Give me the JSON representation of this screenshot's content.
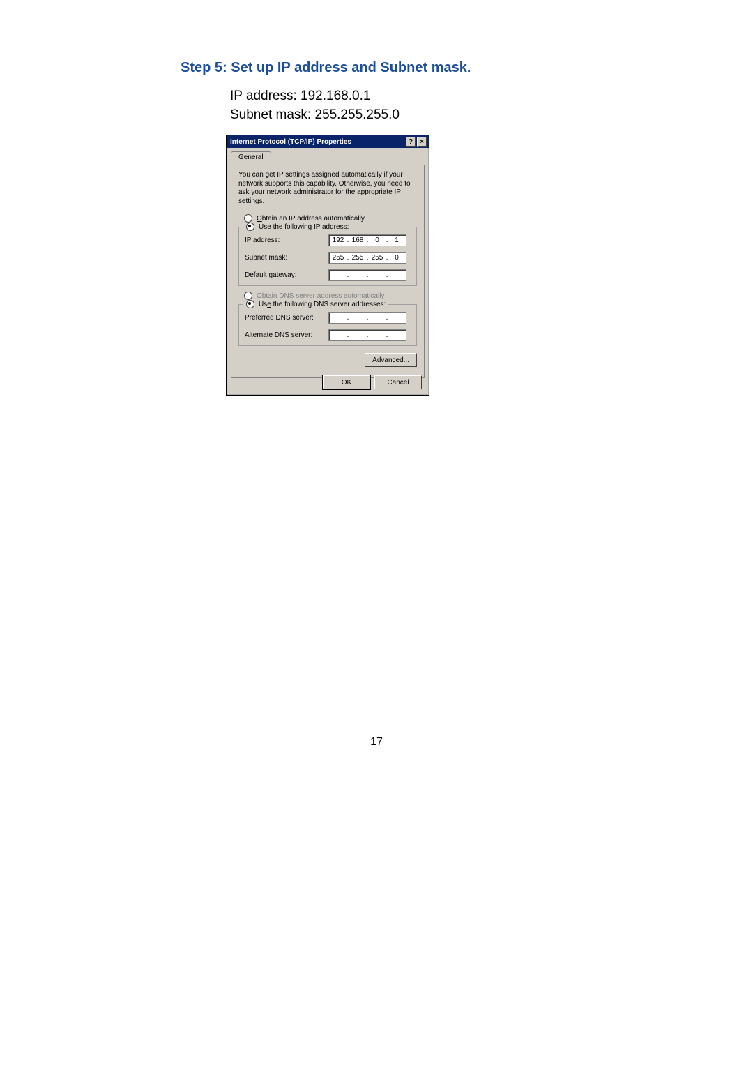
{
  "step": {
    "title": "Step 5:  Set up IP address and Subnet mask."
  },
  "info": {
    "line1": "IP address: 192.168.0.1",
    "line2": "Subnet mask: 255.255.255.0"
  },
  "dialog": {
    "titlebar": {
      "caption": "Internet Protocol (TCP/IP) Properties",
      "help_label": "?",
      "close_label": "×"
    },
    "tab_general": "General",
    "description": "You can get IP settings assigned automatically if your network supports this capability. Otherwise, you need to ask your network administrator for the appropriate IP settings.",
    "ip_section": {
      "radio_obtain_prefix": "O",
      "radio_obtain_suffix": "btain an IP address automatically",
      "radio_use_prefix1": "Us",
      "radio_use_prefix2": "e",
      "radio_use_suffix": " the following IP address:",
      "fields": {
        "ip_label_prefix": "I",
        "ip_label_suffix": "P address:",
        "ip_octets": [
          "192",
          "168",
          "0",
          "1"
        ],
        "subnet_label_prefix1": "S",
        "subnet_label_prefix2": "u",
        "subnet_label_suffix": "bnet mask:",
        "subnet_octets": [
          "255",
          "255",
          "255",
          "0"
        ],
        "gw_label_prefix": "D",
        "gw_label_suffix": "efault gateway:",
        "gw_octets": [
          "",
          "",
          "",
          ""
        ]
      }
    },
    "dns_section": {
      "radio_obtain_prefix1": "O",
      "radio_obtain_prefix2": "b",
      "radio_obtain_suffix": "tain DNS server address automatically",
      "radio_use_prefix1": "Us",
      "radio_use_prefix2": "e",
      "radio_use_suffix": " the following DNS server addresses:",
      "preferred_prefix": "P",
      "preferred_suffix": "referred DNS server:",
      "preferred_octets": [
        "",
        "",
        "",
        ""
      ],
      "alternate_prefix": "A",
      "alternate_suffix": "lternate DNS server:",
      "alternate_octets": [
        "",
        "",
        "",
        ""
      ]
    },
    "buttons": {
      "advanced_prefix": "Ad",
      "advanced_u": "v",
      "advanced_suffix": "anced...",
      "ok": "OK",
      "cancel": "Cancel"
    }
  },
  "page_number": "17"
}
